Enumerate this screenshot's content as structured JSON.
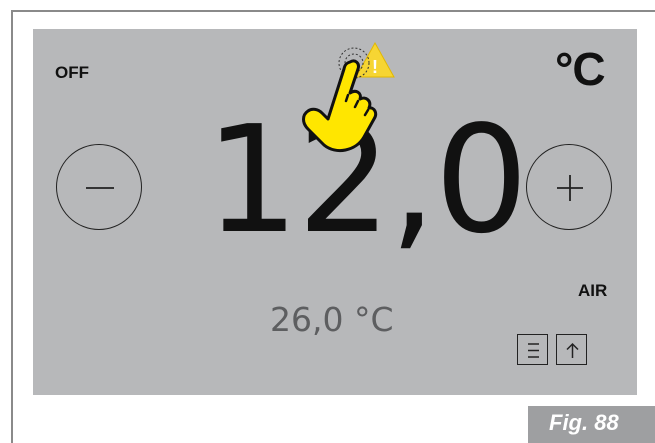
{
  "screen": {
    "power_status": "OFF",
    "unit": "°C",
    "setpoint": "12,0",
    "current_temperature": "26,0 °C",
    "mode": "AIR"
  },
  "buttons": {
    "minus_icon": "minus-icon",
    "plus_icon": "plus-icon",
    "menu_icon": "menu-icon",
    "up_icon": "arrow-up-icon"
  },
  "overlay": {
    "hand_icon": "pointing-hand-icon",
    "warning_icon": "warning-icon",
    "warning_mark": "!"
  },
  "figure": {
    "label": "Fig. 88"
  },
  "colors": {
    "screen_background": "#b7b8ba",
    "hand_fill": "#ffe600",
    "warning_fill": "#f6d533",
    "figure_tag": "#9e9fa1"
  }
}
